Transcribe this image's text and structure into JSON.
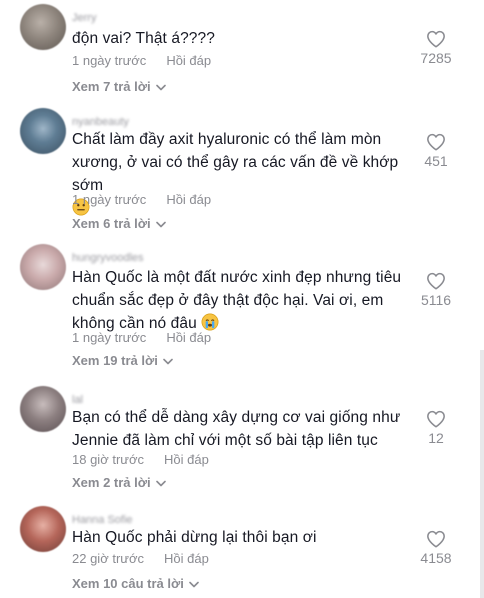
{
  "comments": [
    {
      "username": "Jerry",
      "text": "độn vai? Thật á????",
      "time": "1 ngày trước",
      "reply_label": "Hồi đáp",
      "view_replies": "Xem 7 trả lời",
      "likes": "7285"
    },
    {
      "username": "nyanbeauty",
      "text": "Chất làm đầy axit hyaluronic có thể làm mòn xương, ở vai có thể gây ra các vấn đề về khớp sớm",
      "emoji": "neutral-face-emoji",
      "time": "1 ngày trước",
      "reply_label": "Hồi đáp",
      "view_replies": "Xem 6 trả lời",
      "likes": "451"
    },
    {
      "username": "hungryvoodles",
      "text": "Hàn Quốc là một đất nước xinh đẹp nhưng tiêu chuẩn sắc đẹp ở đây thật độc hại. Vai ơi, em không cần nó đâu",
      "emoji": "crying-face-emoji",
      "time": "1 ngày trước",
      "reply_label": "Hồi đáp",
      "view_replies": "Xem 19 trả lời",
      "likes": "5116"
    },
    {
      "username": "lal",
      "text": "Bạn có thể dễ dàng xây dựng cơ vai giống như Jennie đã làm chỉ với một số bài tập liên tục",
      "time": "18 giờ trước",
      "reply_label": "Hồi đáp",
      "view_replies": "Xem 2 trả lời",
      "likes": "12"
    },
    {
      "username": "Hanna Sofie",
      "text": "Hàn Quốc phải dừng lại thôi bạn ơi",
      "time": "22 giờ trước",
      "reply_label": "Hồi đáp",
      "view_replies": "Xem 10 câu trả lời",
      "likes": "4158"
    }
  ],
  "colors": {
    "text": "#161823",
    "muted": "#8a8b91"
  }
}
